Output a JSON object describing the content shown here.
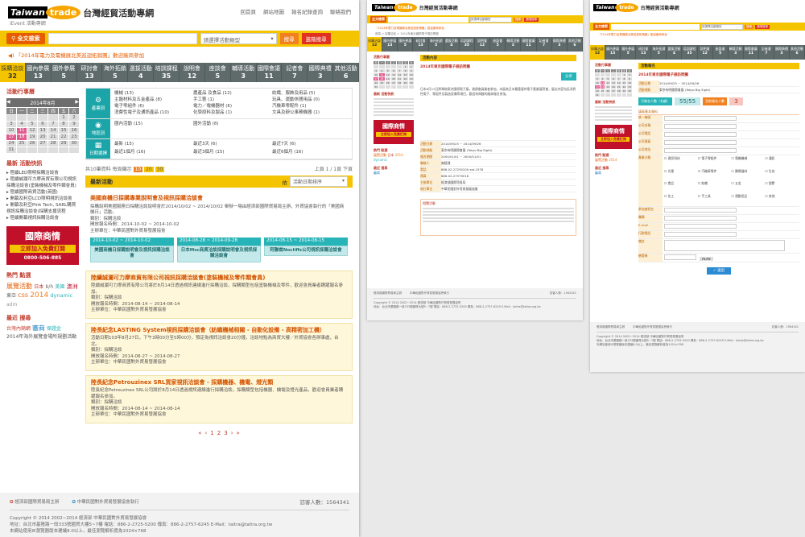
{
  "site": {
    "logo_taiwan": "Taiwan",
    "logo_trade": "trade",
    "logo_sub": "iEvent 活動專網",
    "title": "台灣經貿活動專網",
    "nav": [
      "回首頁",
      "網站地圖",
      "報名紀錄查詢",
      "聯絡我們"
    ]
  },
  "search": {
    "label": "全文檢索",
    "select": "請選擇活動類型",
    "btn_search": "搜尋",
    "btn_advanced": "進階搜尋"
  },
  "marquee": "「2014年電力及電機展北美巡迴拓銷團」歡迎廠商參加",
  "tabs": [
    {
      "label": "採購洽談",
      "count": "32"
    },
    {
      "label": "國內參展",
      "count": "13"
    },
    {
      "label": "國外參展",
      "count": "5"
    },
    {
      "label": "研討會",
      "count": "13"
    },
    {
      "label": "海外拓銷",
      "count": "5"
    },
    {
      "label": "選拔活動",
      "count": "4"
    },
    {
      "label": "培訓課程",
      "count": "35"
    },
    {
      "label": "說明會",
      "count": "12"
    },
    {
      "label": "座談會",
      "count": "5"
    },
    {
      "label": "輔導活動",
      "count": "3"
    },
    {
      "label": "國際會議",
      "count": "11"
    },
    {
      "label": "記者會",
      "count": "7"
    },
    {
      "label": "國際典禮",
      "count": "3"
    },
    {
      "label": "其他活動",
      "count": "6"
    }
  ],
  "calendar": {
    "heading": "活動行事曆",
    "month": "2014年8月",
    "weekdays": [
      "日",
      "一",
      "二",
      "三",
      "四",
      "五",
      "六"
    ],
    "days": [
      "",
      "",
      "",
      "",
      "",
      "1",
      "2",
      "3",
      "4",
      "5",
      "6",
      "7",
      "8",
      "9",
      "10",
      "11",
      "12",
      "13",
      "14",
      "15",
      "16",
      "17",
      "18",
      "19",
      "20",
      "21",
      "22",
      "23",
      "24",
      "25",
      "26",
      "27",
      "28",
      "29",
      "30",
      "31",
      "",
      "",
      "",
      "",
      "",
      ""
    ],
    "highlights": [
      "11",
      "17",
      "18"
    ]
  },
  "recent_events": {
    "heading": "最新 活動快訊",
    "items": [
      "陸續LED照明採購洽談會",
      "陸續誠瀾可力摩商貿有限公司視訊採購洽談會(塗裝機械及零件類會員)",
      "陸續國際商貿活動(英國)",
      "開幕及利亞LCD照明視訊洽談會",
      "開幕及利亞Pink Tech, SARL購買視訊採購洽談會(採購支援流程",
      "陸續開幕視訊採購洽談會"
    ]
  },
  "ad": {
    "line1": "國際商情",
    "line2": "立即加入免費訂閱",
    "phone": "0800-506-885"
  },
  "hot_tags": {
    "heading": "熱門 點選",
    "tags": [
      "展覽活動",
      "日本",
      "b/h",
      "美國",
      "澳洲",
      "東亞",
      "CSS",
      "2014",
      "dynamic",
      "adm"
    ]
  },
  "latest_search": {
    "heading": "最近 搜尋",
    "items": [
      "台灣內銷網",
      "審商",
      "保證金",
      "2014年海外展覽會場所規劃活動"
    ]
  },
  "categories": [
    {
      "name": "產業別",
      "items": [
        "機械 (13)",
        "農產品 及食品 (12)",
        "紡織、服飾及用品 (5)",
        "主題材料及五金產品 (8)",
        "手工藝 (1)",
        "玩具、運動休閒用品 (0)",
        "電子零組件 (6)",
        "電力／電機器材 (6)",
        "汽機車零配件 (1)",
        "消費性電子及通訊產品 (10)",
        "化學原料及製品 (1)",
        "文具及辦公事務機器 (1)"
      ]
    },
    {
      "name": "地區別",
      "items": [
        "國內活動 (15)",
        "國外活動 (8)"
      ]
    },
    {
      "name": "日期選擇",
      "items": [
        "最新 (15)",
        "最近3天 (6)",
        "最近7天 (6)",
        "最近1個月 (16)",
        "最近3個月 (15)",
        "最近6個月 (16)"
      ]
    }
  ],
  "list_tools": {
    "found": "共10筆資料",
    "perpage_label": "每頁顯示",
    "perpage": [
      "10",
      "20",
      "30"
    ],
    "pager": "上頁 1 / 1頁 下頁"
  },
  "latest": {
    "heading": "最新活動",
    "sort_label": "依",
    "sort_select": "活動日期排序"
  },
  "events": [
    {
      "title": "美國商機日採購專業說明會及視訊採購洽談會",
      "desc": "採購說明美國服務日採購洽談說明會於2014/10/02 ~ 2014/10/02 舉辦一場由經濟部國際貿易局主辦，外貿協會執行的「美國商機日」活動。",
      "type": "類別：採購洽談",
      "date": "開放報名時間：2014-10-02 ~ 2014-10-02",
      "org": "主辦單位：中華民國對外貿易發展協會",
      "sessions": [
        {
          "date": "2014-10-02 ~ 2014-10-02",
          "title": "美國商機日採購說明會及視訊採購洽談會"
        },
        {
          "date": "2014-08-28 ~ 2014-09-28",
          "title": "日本Msc商貿洽談採購說明會及視訊採購洽談會"
        },
        {
          "date": "2014-08-15 ~ 2014-08-15",
          "title": "阿聯酋Nocliffs公司視訊採購洽談會"
        }
      ]
    },
    {
      "title": "陸續誠瀾可力摩商貿有限公司視訊採購洽談會(塗裝機械及零件類會員)",
      "desc": "陸續誠瀾可力摩商貿有限公司將於8月14日透過視訊連線進行採購洽談，採購類型包括塗裝機械及零件，歡迎會員業者踴躍報名參加。",
      "type": "類別：採購洽談",
      "date": "開放報名時間：2014-08-14 ~ 2014-08-14",
      "org": "主辦單位：中華民國對外貿易發展協會"
    },
    {
      "title": "陸長紀念LASTING System視訊採購洽談會（紡織機械相關 - 自動化設備 - 高精密加工機）",
      "desc": "活動日期103年8月27日，下午3時00分至5時00分，預定為視訊洽談會20分鐘，洽談地點為商貿大樓／外貿協會各辦事處，台北。",
      "type": "類別：採購洽談",
      "date": "開放報名時間：2014-08-27 ~ 2014-08-27",
      "org": "主辦單位：中華民國對外貿易發展協會"
    },
    {
      "title": "陸長紀念Petrouzinex SRL買家視訊洽談會 - 採購機器、機電、燈光類",
      "desc": "陸長紀念Petrouzinex SRL公司將於8月14日透過視訊連線進行採購洽談，採購類型包括機器、機電及燈光產品，歡迎會員業者踴躍報名參加。",
      "type": "類別：採購洽談",
      "date": "開放報名時間：2014-08-14 ~ 2014-08-14",
      "org": "主辦單位：中華民國對外貿易發展協會"
    }
  ],
  "pager": [
    "«",
    "‹",
    "1",
    "2",
    "3",
    "›",
    "»"
  ],
  "footer": {
    "sponsor1": "經濟部國際貿易局主辦",
    "sponsor2": "中華民國對外貿易發展協會執行",
    "visitors": "訪客人數：1564341",
    "copy": "Copyright © 2014 2002~2014 經濟部 中華民國對外貿易發展協會",
    "address": "地址：台北市基隆路一段333號國貿大樓5~7樓   電話：886-2-2725-5200   傳真：886-2-2757-6245   E-Mail：taitra@taitra.org.tw",
    "note": "本網站使用IE瀏覽器版本建議8.0以上，最佳瀏覽解析度為1024×768"
  },
  "detail": {
    "breadcrumb": "首頁 > 採購洽談 > 2014年東京國際電子展訪問團",
    "title": "2014年東京國際電子展訪問團",
    "intro": "日本8月15日將舉辦東京國際電子展，邀請會員業者參加，本展為日本最重要的電子產業展覽會，展出內容包括消費性電子、零組件及製造設備等項目，歡迎有興趣的廠商報名參加。",
    "fields": [
      {
        "k": "活動日期",
        "v": "2014/09/25 ~ 2014/09/26"
      },
      {
        "k": "活動地點",
        "v": "東京有明國際會展 (Tokyo Big Sight)"
      },
      {
        "k": "報名期間",
        "v": "2000/01/01 ~ 2000/01/01"
      },
      {
        "k": "聯絡人",
        "v": "謝經理"
      },
      {
        "k": "電話",
        "v": "886-02-27255200 ext.1578"
      },
      {
        "k": "傳真",
        "v": "886-02-27579018"
      },
      {
        "k": "主辦單位",
        "v": "經濟部國際貿易局"
      },
      {
        "k": "執行單位",
        "v": "中華民國對外貿易發展協會"
      }
    ],
    "share": "分享"
  },
  "form": {
    "heading": "活動報名",
    "title": "2014年東京國際電子展訪問團",
    "rows": [
      {
        "k": "活動日期",
        "v": "2014/09/25 ~ 2014/09/26"
      },
      {
        "k": "活動地點",
        "v": "東京有明國際會展 (Tokyo Big Sight)"
      }
    ],
    "quota_label": "可報名人數（名額）",
    "quota": "55/55",
    "reg_label": "目前報名人數",
    "reg": "3",
    "section": "填寫基本資料",
    "labels": [
      "統一編號",
      "公司名稱",
      "公司電話",
      "公司傳真",
      "公司地址",
      "產業分類",
      "參加者姓名",
      "職稱",
      "E-mail",
      "行動電話",
      "備註",
      "驗證碼"
    ],
    "checks": [
      "資訊科技",
      "電子零組件",
      "電機機械",
      "通訊",
      "光電",
      "汽機車零件",
      "醫療器材",
      "生技",
      "食品",
      "紡織",
      "五金",
      "塑膠",
      "化工",
      "手工具",
      "運動用品",
      "其他"
    ],
    "captcha": "PLP8",
    "submit": "送出"
  },
  "colors": {
    "brand_yellow": "#f5c400",
    "teal": "#27b4b8",
    "orange": "#f08020",
    "red": "#e03020",
    "tab_gray": "#5f6b6b"
  }
}
